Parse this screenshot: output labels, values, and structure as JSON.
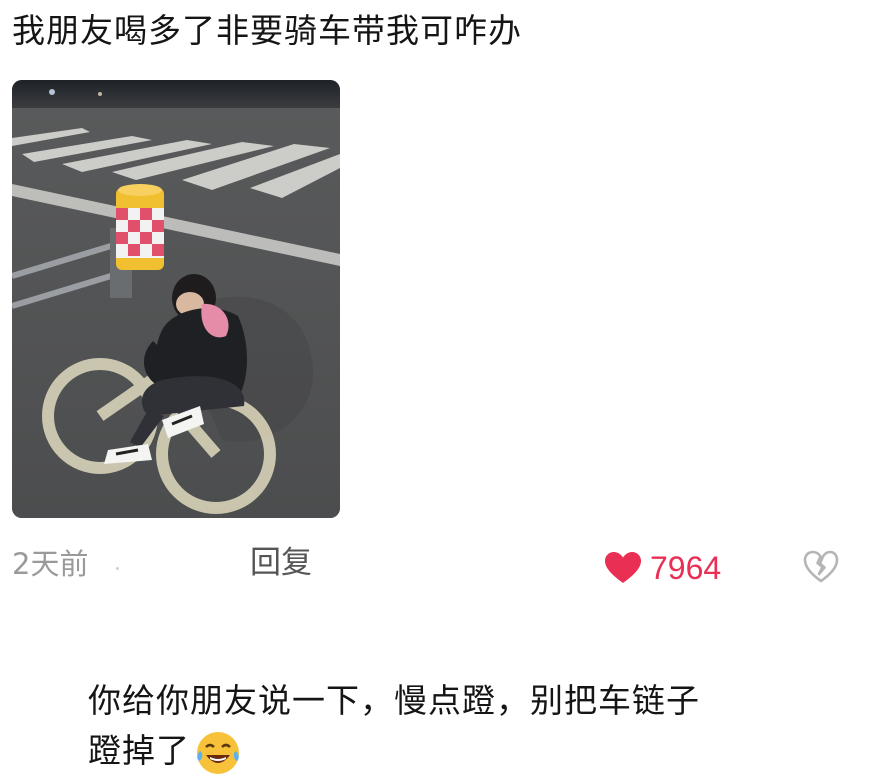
{
  "post": {
    "title": "我朋友喝多了非要骑车带我可咋办",
    "photo": {
      "icon": "photo-thumbnail"
    }
  },
  "meta": {
    "time": "2天前",
    "reply_label": "回复",
    "likes": "7964",
    "like_icon": "heart-icon",
    "dislike_icon": "broken-heart-icon",
    "like_color": "#ea2f54"
  },
  "comment": {
    "line1": "你给你朋友说一下，慢点蹬，别把车链子",
    "line2": "蹬掉了",
    "emoji_icon": "laughing-tears-emoji"
  }
}
